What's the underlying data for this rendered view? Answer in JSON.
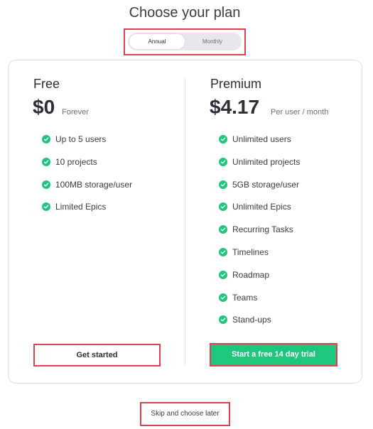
{
  "page": {
    "title": "Choose your plan"
  },
  "billing_toggle": {
    "annual": "Annual",
    "monthly": "Monthly",
    "selected": "Annual"
  },
  "plans": [
    {
      "name": "Free",
      "price": "$0",
      "price_note": "Forever",
      "features": [
        "Up to 5 users",
        "10 projects",
        "100MB storage/user",
        "Limited Epics"
      ],
      "cta": "Get started"
    },
    {
      "name": "Premium",
      "price": "$4.17",
      "price_note": "Per user / month",
      "features": [
        "Unlimited users",
        "Unlimited projects",
        "5GB storage/user",
        "Unlimited Epics",
        "Recurring Tasks",
        "Timelines",
        "Roadmap",
        "Teams",
        "Stand-ups"
      ],
      "cta": "Start a free 14 day trial"
    }
  ],
  "skip_label": "Skip and choose later",
  "colors": {
    "accent_green": "#1fc77e",
    "annotation_red": "#e0404f"
  }
}
